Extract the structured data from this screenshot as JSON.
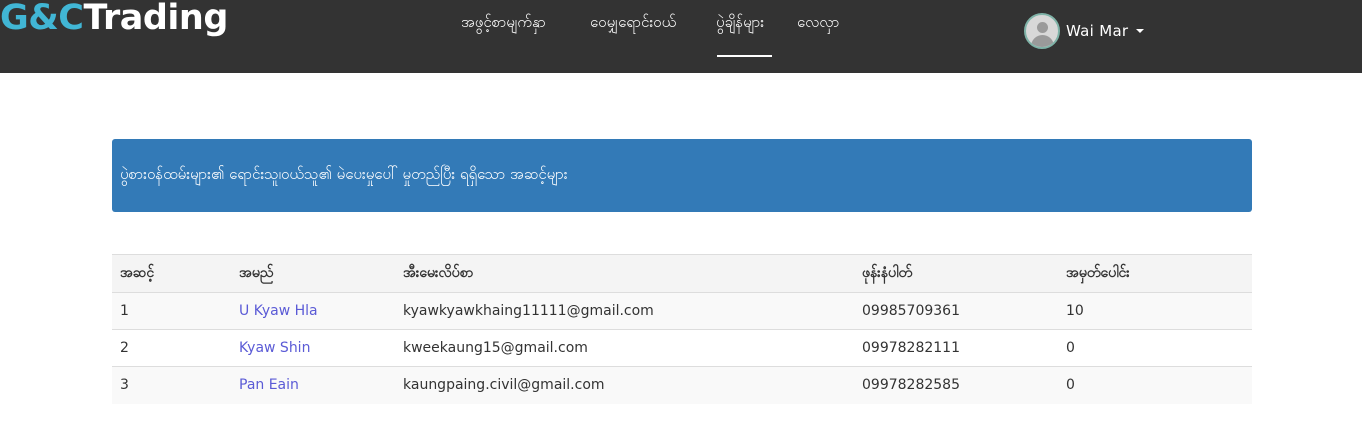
{
  "brand": {
    "part1": "G&C",
    "part2": "Trading"
  },
  "nav": {
    "items": [
      {
        "label": "အဖွင့်စာမျက်နှာ"
      },
      {
        "label": "ဝေမျှရောင်းဝယ်"
      },
      {
        "label": "ပွဲချိန်များ"
      },
      {
        "label": "လေလှာ"
      }
    ],
    "active_index": 2
  },
  "user": {
    "name": "Wai Mar"
  },
  "panel": {
    "text": "ပွဲစားဝန်ထမ်းများ၏ ရောင်းသူ၊ဝယ်သူ၏ မဲပေးမှုပေါ် မှုတည်ပြီး ရရှိသော အဆင့်များ"
  },
  "table": {
    "headers": [
      "အဆင့်",
      "အမည်",
      "အီးမေးလိပ်စာ",
      "ဖုန်းနံပါတ်",
      "အမှတ်ပေါင်း"
    ],
    "rows": [
      {
        "rank": "1",
        "name": "U Kyaw Hla",
        "email": "kyawkyawkhaing11111@gmail.com",
        "phone": "09985709361",
        "points": "10"
      },
      {
        "rank": "2",
        "name": "Kyaw Shin",
        "email": "kweekaung15@gmail.com",
        "phone": "09978282111",
        "points": "0"
      },
      {
        "rank": "3",
        "name": "Pan Eain",
        "email": "kaungpaing.civil@gmail.com",
        "phone": "09978282585",
        "points": "0"
      }
    ]
  },
  "colors": {
    "topbar": "#333333",
    "brand_accent": "#41b6d5",
    "panel": "#337ab7",
    "link": "#5b5bd6"
  }
}
